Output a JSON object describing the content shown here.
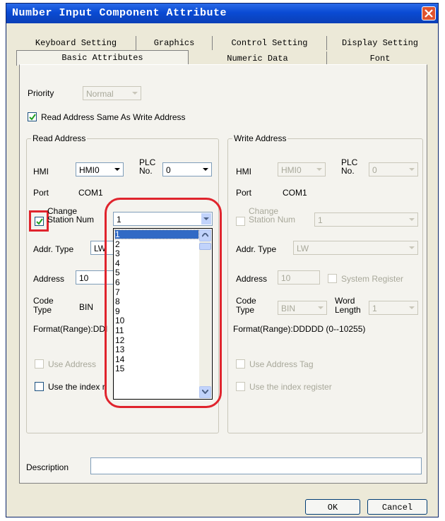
{
  "window": {
    "title": "Number Input Component Attribute"
  },
  "tabs": {
    "row1": [
      "Keyboard Setting",
      "Graphics",
      "Control Setting",
      "Display Setting"
    ],
    "row2": [
      "Basic Attributes",
      "Numeric Data",
      "Font"
    ],
    "active": "Basic Attributes"
  },
  "priority": {
    "label": "Priority",
    "value": "Normal"
  },
  "read_same_as_write": {
    "label": "Read Address Same As Write Address",
    "checked": true
  },
  "read_address": {
    "title": "Read Address",
    "hmi_label": "HMI",
    "hmi_value": "HMI0",
    "plc_label_1": "PLC",
    "plc_label_2": "No.",
    "plc_value": "0",
    "port_label": "Port",
    "port_value": "COM1",
    "change_station_label_1": "Change",
    "change_station_label_2": "Station Num",
    "change_station_checked": true,
    "change_station_value": "1",
    "addr_type_label": "Addr. Type",
    "addr_type_value": "LW",
    "address_label": "Address",
    "address_value": "10",
    "code_label_1": "Code",
    "code_label_2": "Type",
    "code_value": "BIN",
    "format_label": "Format(Range):DDI",
    "use_address_tag": "Use Address",
    "use_index": "Use the index r"
  },
  "station_dropdown": {
    "options": [
      "1",
      "2",
      "3",
      "4",
      "5",
      "6",
      "7",
      "8",
      "9",
      "10",
      "11",
      "12",
      "13",
      "14",
      "15"
    ],
    "selected": "1"
  },
  "write_address": {
    "title": "Write Address",
    "hmi_label": "HMI",
    "hmi_value": "HMI0",
    "plc_label_1": "PLC",
    "plc_label_2": "No.",
    "plc_value": "0",
    "port_label": "Port",
    "port_value": "COM1",
    "change_station_label_1": "Change",
    "change_station_label_2": "Station Num",
    "change_station_value": "1",
    "addr_type_label": "Addr. Type",
    "addr_type_value": "LW",
    "address_label": "Address",
    "address_value": "10",
    "system_register": "System Register",
    "code_label_1": "Code",
    "code_label_2": "Type",
    "code_value": "BIN",
    "word_length_label_1": "Word",
    "word_length_label_2": "Length",
    "word_length_value": "1",
    "format_label": "Format(Range):DDDDD (0--10255)",
    "use_address_tag": "Use Address Tag",
    "use_index": "Use the index register"
  },
  "description": {
    "label": "Description",
    "value": ""
  },
  "buttons": {
    "ok": "OK",
    "cancel": "Cancel"
  },
  "colors": {
    "title_bar": "#0a4bd4",
    "highlight": "#e0242d",
    "selection": "#316ac5"
  }
}
